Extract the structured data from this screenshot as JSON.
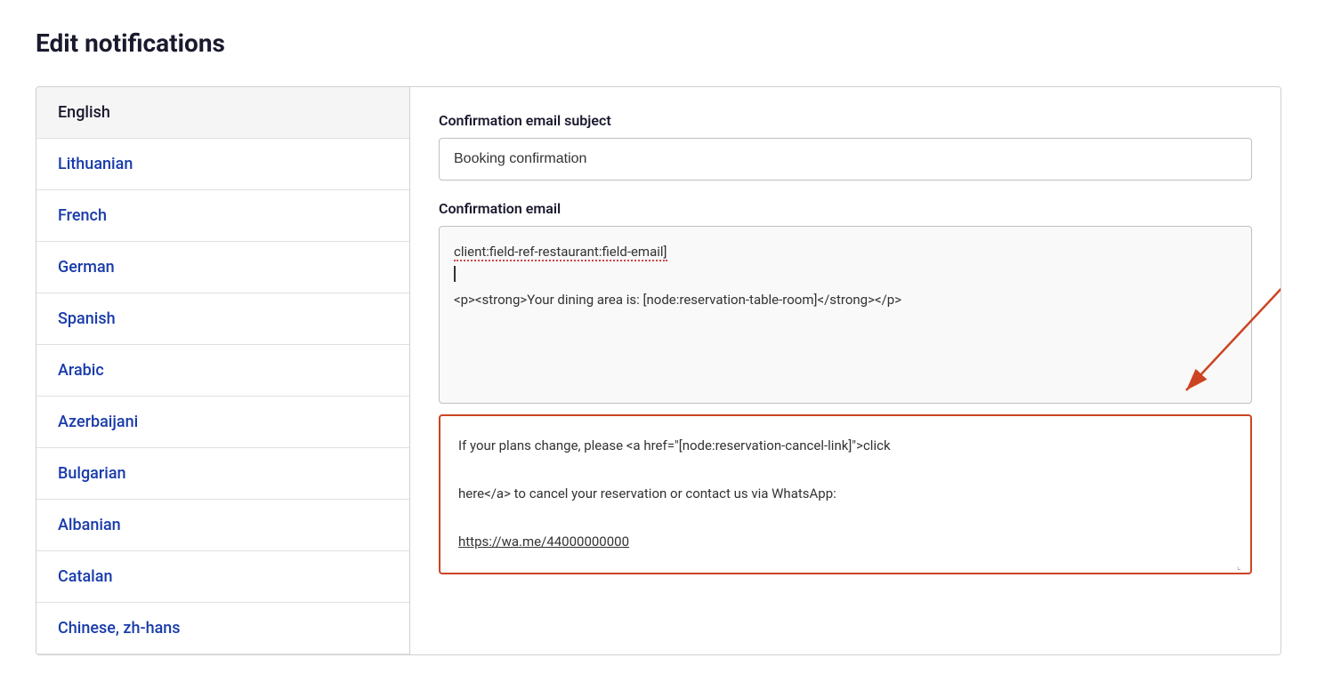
{
  "page": {
    "title": "Edit notifications"
  },
  "sidebar": {
    "languages": [
      {
        "id": "english",
        "label": "English",
        "style": "selected"
      },
      {
        "id": "lithuanian",
        "label": "Lithuanian",
        "style": "blue"
      },
      {
        "id": "french",
        "label": "French",
        "style": "blue"
      },
      {
        "id": "german",
        "label": "German",
        "style": "blue"
      },
      {
        "id": "spanish",
        "label": "Spanish",
        "style": "blue"
      },
      {
        "id": "arabic",
        "label": "Arabic",
        "style": "blue"
      },
      {
        "id": "azerbaijani",
        "label": "Azerbaijani",
        "style": "blue"
      },
      {
        "id": "bulgarian",
        "label": "Bulgarian",
        "style": "blue"
      },
      {
        "id": "albanian",
        "label": "Albanian",
        "style": "blue"
      },
      {
        "id": "catalan",
        "label": "Catalan",
        "style": "blue"
      },
      {
        "id": "chinese-zh-hans",
        "label": "Chinese, zh-hans",
        "style": "blue"
      }
    ]
  },
  "content": {
    "subject_label": "Confirmation email subject",
    "subject_value": "Booking confirmation",
    "email_label": "Confirmation email",
    "email_token": "client:field-ref-restaurant:field-email]",
    "email_html_line": "<p><strong>Your dining area is: [node:reservation-table-room]</strong></p>",
    "highlighted_text_line1": "If your plans change, please <a href=\"[node:reservation-cancel-link]\">click",
    "highlighted_text_line2": "here</a> to cancel your reservation or contact us via WhatsApp:",
    "highlighted_text_link": "https://wa.me/44000000000"
  }
}
